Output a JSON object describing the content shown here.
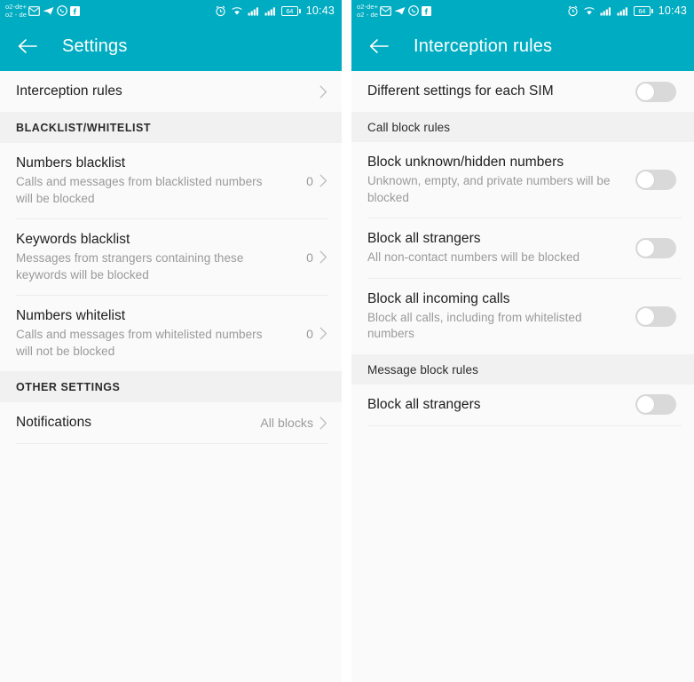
{
  "status_bar": {
    "carrier_line1": "o2-de+",
    "carrier_line2": "o2 - de",
    "icons": [
      "email-icon",
      "telegram-icon",
      "whatsapp-icon",
      "facebook-icon"
    ],
    "right_icons": [
      "alarm-icon",
      "wifi-icon",
      "signal-sim1-icon",
      "signal-sim2-icon"
    ],
    "battery_level": "64",
    "time": "10:43"
  },
  "theme": {
    "accent": "#00acc1",
    "background": "#fafafa",
    "section_header_bg": "#f1f1f1",
    "divider": "#ececec",
    "toggle_track_off": "#d9d9d9",
    "title_color": "#1d1d1d",
    "subtitle_color": "#9a9a9a"
  },
  "left_screen": {
    "appbar": {
      "back_icon": "back-arrow-icon",
      "title": "Settings"
    },
    "top_items": [
      {
        "title": "Interception rules",
        "subtitle": "",
        "value": "",
        "chevron": true
      }
    ],
    "sections": [
      {
        "header": "BLACKLIST/WHITELIST",
        "style": "caps",
        "items": [
          {
            "title": "Numbers blacklist",
            "subtitle": "Calls and messages from blacklisted numbers will be blocked",
            "value": "0",
            "chevron": true
          },
          {
            "title": "Keywords blacklist",
            "subtitle": "Messages from strangers containing these keywords will be blocked",
            "value": "0",
            "chevron": true
          },
          {
            "title": "Numbers whitelist",
            "subtitle": "Calls and messages from whitelisted numbers will not be blocked",
            "value": "0",
            "chevron": true
          }
        ]
      },
      {
        "header": "OTHER SETTINGS",
        "style": "caps",
        "items": [
          {
            "title": "Notifications",
            "subtitle": "",
            "value": "All blocks",
            "chevron": true
          }
        ]
      }
    ]
  },
  "right_screen": {
    "appbar": {
      "back_icon": "back-arrow-icon",
      "title": "Interception rules"
    },
    "top_items": [
      {
        "title": "Different settings for each SIM",
        "subtitle": "",
        "toggle": "off"
      }
    ],
    "sections": [
      {
        "header": "Call block rules",
        "style": "sentence",
        "items": [
          {
            "title": "Block unknown/hidden numbers",
            "subtitle": "Unknown, empty, and private numbers will be blocked",
            "toggle": "off"
          },
          {
            "title": "Block all strangers",
            "subtitle": "All non-contact numbers will be blocked",
            "toggle": "off"
          },
          {
            "title": "Block all incoming calls",
            "subtitle": "Block all calls, including from whitelisted numbers",
            "toggle": "off"
          }
        ]
      },
      {
        "header": "Message block rules",
        "style": "sentence",
        "items": [
          {
            "title": "Block all strangers",
            "subtitle": "",
            "toggle": "off"
          }
        ]
      }
    ]
  }
}
